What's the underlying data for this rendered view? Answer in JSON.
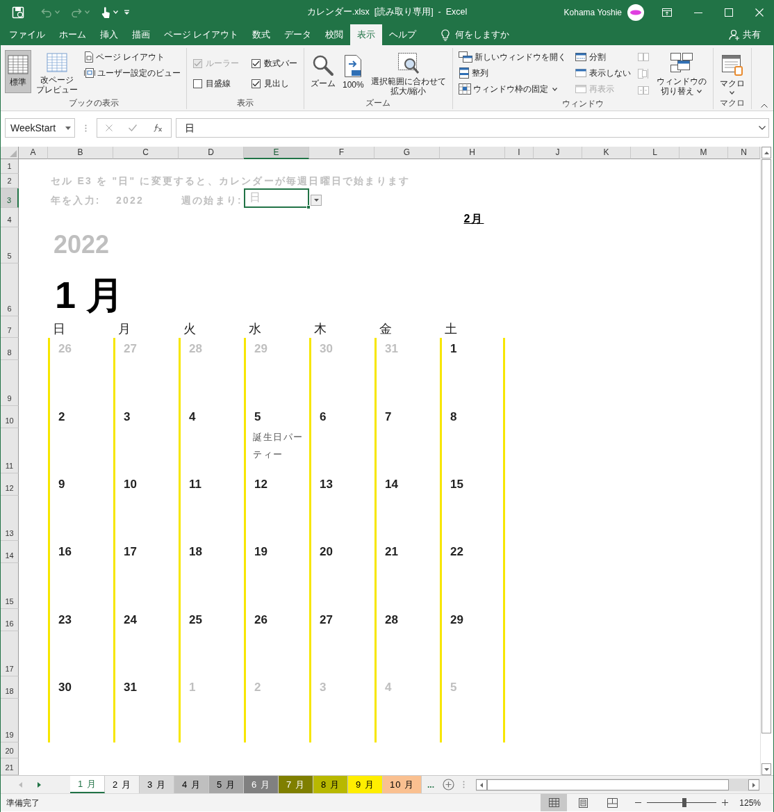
{
  "title_bar": {
    "title": "カレンダー.xlsx  [読み取り専用]  -  Excel",
    "user": "Kohama Yoshie"
  },
  "ribbon_tabs": [
    {
      "label": "ファイル",
      "selected": false
    },
    {
      "label": "ホーム",
      "selected": false
    },
    {
      "label": "挿入",
      "selected": false
    },
    {
      "label": "描画",
      "selected": false
    },
    {
      "label": "ページ レイアウト",
      "selected": false
    },
    {
      "label": "数式",
      "selected": false
    },
    {
      "label": "データ",
      "selected": false
    },
    {
      "label": "校閲",
      "selected": false
    },
    {
      "label": "表示",
      "selected": true
    },
    {
      "label": "ヘルプ",
      "selected": false
    }
  ],
  "tell_me": "何をしますか",
  "share": "共有",
  "ribbon_groups": [
    {
      "label": "ブックの表示",
      "columns": [
        [
          {
            "kind": "large",
            "lines": [
              "標準"
            ],
            "selected": true,
            "disabled": false
          }
        ],
        [
          {
            "kind": "large",
            "lines": [
              "改ページ",
              "プレビュー"
            ],
            "selected": false,
            "disabled": false
          }
        ],
        [
          {
            "kind": "small",
            "label": "ページ レイアウト",
            "disabled": false
          },
          {
            "kind": "small",
            "label": "ユーザー設定のビュー",
            "disabled": false
          }
        ]
      ]
    },
    {
      "label": "表示",
      "columns": [
        [
          {
            "kind": "check",
            "label": "ルーラー",
            "checked": true,
            "disabled": true
          },
          {
            "kind": "check",
            "label": "目盛線",
            "checked": false,
            "disabled": false
          }
        ],
        [
          {
            "kind": "check",
            "label": "数式バー",
            "checked": true,
            "disabled": false
          },
          {
            "kind": "check",
            "label": "見出し",
            "checked": true,
            "disabled": false
          }
        ]
      ]
    },
    {
      "label": "ズーム",
      "columns": [
        [
          {
            "kind": "large",
            "lines": [
              "ズーム"
            ],
            "disabled": false
          }
        ],
        [
          {
            "kind": "large",
            "lines": [
              "100%"
            ],
            "disabled": false
          }
        ],
        [
          {
            "kind": "large",
            "lines": [
              "選択範囲に合わせて",
              "拡大/縮小"
            ],
            "disabled": false
          }
        ]
      ]
    },
    {
      "label": "ウィンドウ",
      "columns": [
        [
          {
            "kind": "small",
            "label": "新しいウィンドウを開く",
            "disabled": false
          },
          {
            "kind": "small",
            "label": "整列",
            "disabled": false
          },
          {
            "kind": "small",
            "label": "ウィンドウ枠の固定",
            "dropdown": true,
            "disabled": false
          }
        ],
        [
          {
            "kind": "small",
            "label": "分割",
            "disabled": false
          },
          {
            "kind": "small",
            "label": "表示しない",
            "disabled": false
          },
          {
            "kind": "small",
            "label": "再表示",
            "disabled": true
          }
        ],
        [
          {
            "kind": "icon",
            "disabled": true
          },
          {
            "kind": "icon",
            "disabled": true
          },
          {
            "kind": "icon",
            "disabled": true
          }
        ],
        [
          {
            "kind": "large",
            "lines": [
              "ウィンドウの",
              "切り替え"
            ],
            "dropdown": true,
            "disabled": false
          }
        ]
      ]
    },
    {
      "label": "マクロ",
      "columns": [
        [
          {
            "kind": "large",
            "lines": [
              "マクロ"
            ],
            "dropdown": true,
            "disabled": false
          }
        ]
      ]
    }
  ],
  "formula_bar": {
    "name_box": "WeekStart",
    "formula": "日"
  },
  "columns": [
    {
      "label": "A",
      "selected": false
    },
    {
      "label": "B",
      "selected": false
    },
    {
      "label": "C",
      "selected": false
    },
    {
      "label": "D",
      "selected": false
    },
    {
      "label": "E",
      "selected": true
    },
    {
      "label": "F",
      "selected": false
    },
    {
      "label": "G",
      "selected": false
    },
    {
      "label": "H",
      "selected": false
    },
    {
      "label": "I",
      "selected": false
    },
    {
      "label": "J",
      "selected": false
    },
    {
      "label": "K",
      "selected": false
    },
    {
      "label": "L",
      "selected": false
    },
    {
      "label": "M",
      "selected": false
    },
    {
      "label": "N",
      "selected": false
    }
  ],
  "rows": [
    {
      "label": "1",
      "selected": false
    },
    {
      "label": "2",
      "selected": false
    },
    {
      "label": "3",
      "selected": true
    },
    {
      "label": "4",
      "selected": false
    },
    {
      "label": "5",
      "selected": false
    },
    {
      "label": "6",
      "selected": false
    },
    {
      "label": "7",
      "selected": false
    },
    {
      "label": "8",
      "selected": false
    },
    {
      "label": "9",
      "selected": false
    },
    {
      "label": "10",
      "selected": false
    },
    {
      "label": "11",
      "selected": false
    },
    {
      "label": "12",
      "selected": false
    },
    {
      "label": "13",
      "selected": false
    },
    {
      "label": "14",
      "selected": false
    },
    {
      "label": "15",
      "selected": false
    },
    {
      "label": "16",
      "selected": false
    },
    {
      "label": "17",
      "selected": false
    },
    {
      "label": "18",
      "selected": false
    },
    {
      "label": "19",
      "selected": false
    },
    {
      "label": "20",
      "selected": false
    },
    {
      "label": "21",
      "selected": false
    }
  ],
  "sheet": {
    "instruction": "セル E3 を \"日\" に変更すると、カレンダーが毎週日曜日で始まります",
    "year_label": "年を入力:",
    "year_input": "2022",
    "week_start_label": "週の始まり:",
    "week_start_value": "日",
    "next_month_link": "2月",
    "year": "2022",
    "month": "1 月",
    "weekdays": [
      "日",
      "月",
      "火",
      "水",
      "木",
      "金",
      "土"
    ],
    "weeks": [
      [
        {
          "day": "26",
          "muted": true
        },
        {
          "day": "27",
          "muted": true
        },
        {
          "day": "28",
          "muted": true
        },
        {
          "day": "29",
          "muted": true
        },
        {
          "day": "30",
          "muted": true
        },
        {
          "day": "31",
          "muted": true
        },
        {
          "day": "1",
          "muted": false
        }
      ],
      [
        {
          "day": "2",
          "muted": false
        },
        {
          "day": "3",
          "muted": false
        },
        {
          "day": "4",
          "muted": false
        },
        {
          "day": "5",
          "muted": false,
          "event": "誕生日パーティー"
        },
        {
          "day": "6",
          "muted": false
        },
        {
          "day": "7",
          "muted": false
        },
        {
          "day": "8",
          "muted": false
        }
      ],
      [
        {
          "day": "9",
          "muted": false
        },
        {
          "day": "10",
          "muted": false
        },
        {
          "day": "11",
          "muted": false
        },
        {
          "day": "12",
          "muted": false
        },
        {
          "day": "13",
          "muted": false
        },
        {
          "day": "14",
          "muted": false
        },
        {
          "day": "15",
          "muted": false
        }
      ],
      [
        {
          "day": "16",
          "muted": false
        },
        {
          "day": "17",
          "muted": false
        },
        {
          "day": "18",
          "muted": false
        },
        {
          "day": "19",
          "muted": false
        },
        {
          "day": "20",
          "muted": false
        },
        {
          "day": "21",
          "muted": false
        },
        {
          "day": "22",
          "muted": false
        }
      ],
      [
        {
          "day": "23",
          "muted": false
        },
        {
          "day": "24",
          "muted": false
        },
        {
          "day": "25",
          "muted": false
        },
        {
          "day": "26",
          "muted": false
        },
        {
          "day": "27",
          "muted": false
        },
        {
          "day": "28",
          "muted": false
        },
        {
          "day": "29",
          "muted": false
        }
      ],
      [
        {
          "day": "30",
          "muted": false
        },
        {
          "day": "31",
          "muted": false
        },
        {
          "day": "1",
          "muted": true
        },
        {
          "day": "2",
          "muted": true
        },
        {
          "day": "3",
          "muted": true
        },
        {
          "day": "4",
          "muted": true
        },
        {
          "day": "5",
          "muted": true
        }
      ]
    ]
  },
  "sheet_tabs": [
    {
      "label": "1 月",
      "selected": true,
      "color": "#ffffff"
    },
    {
      "label": "2 月",
      "selected": false,
      "color": "#f2f2f2"
    },
    {
      "label": "3 月",
      "selected": false,
      "color": "#d9d9d9"
    },
    {
      "label": "4 月",
      "selected": false,
      "color": "#bfbfbf"
    },
    {
      "label": "5 月",
      "selected": false,
      "color": "#a6a6a6"
    },
    {
      "label": "6 月",
      "selected": false,
      "color": "#808080"
    },
    {
      "label": "7 月",
      "selected": false,
      "color": "#7f7f00"
    },
    {
      "label": "8 月",
      "selected": false,
      "color": "#b8b800"
    },
    {
      "label": "9 月",
      "selected": false,
      "color": "#ffee00"
    },
    {
      "label": "10 月",
      "selected": false,
      "color": "#fac090"
    }
  ],
  "more_tabs": "...",
  "status_bar": {
    "status": "準備完了",
    "views": [
      {
        "selected": true
      },
      {
        "selected": false
      },
      {
        "selected": false
      }
    ],
    "zoom": {
      "level": 0.54,
      "reading": "125%"
    }
  }
}
